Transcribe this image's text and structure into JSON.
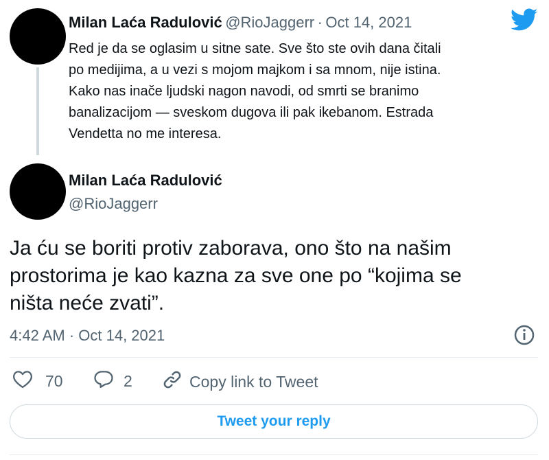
{
  "parent_tweet": {
    "display_name": "Milan Laća Radulović",
    "handle": "@RioJaggerr",
    "separator": "·",
    "date": "Oct 14, 2021",
    "lines": [
      "Red je da se oglasim u sitne sate. Sve što ste ovih dana čitali",
      "po medijima, a u vezi s mojom majkom i sa mnom, nije istina.",
      "Kako nas inače ljudski nagon navodi, od smrti se branimo",
      "banalizacijom — sveskom dugova ili pak ikebanom. Estrada",
      "Vendetta no me interesa."
    ]
  },
  "main_tweet": {
    "display_name": "Milan Laća Radulović",
    "handle": "@RioJaggerr",
    "lines": [
      "Ja ću se boriti protiv zaborava, ono što na našim",
      "prostorima je kao kazna za sve one po “kojima se",
      "ništa neće zvati”."
    ],
    "timestamp": "4:42 AM · Oct 14, 2021"
  },
  "actions": {
    "likes": "70",
    "replies": "2",
    "copy_link_label": "Copy link to Tweet"
  },
  "reply_button_label": "Tweet your reply",
  "colors": {
    "accent": "#1d9bf0",
    "secondary_text": "#536471",
    "divider": "#e6ecf0"
  },
  "icons": [
    "twitter-bird-icon",
    "info-icon",
    "heart-icon",
    "reply-bubble-icon",
    "link-icon"
  ]
}
